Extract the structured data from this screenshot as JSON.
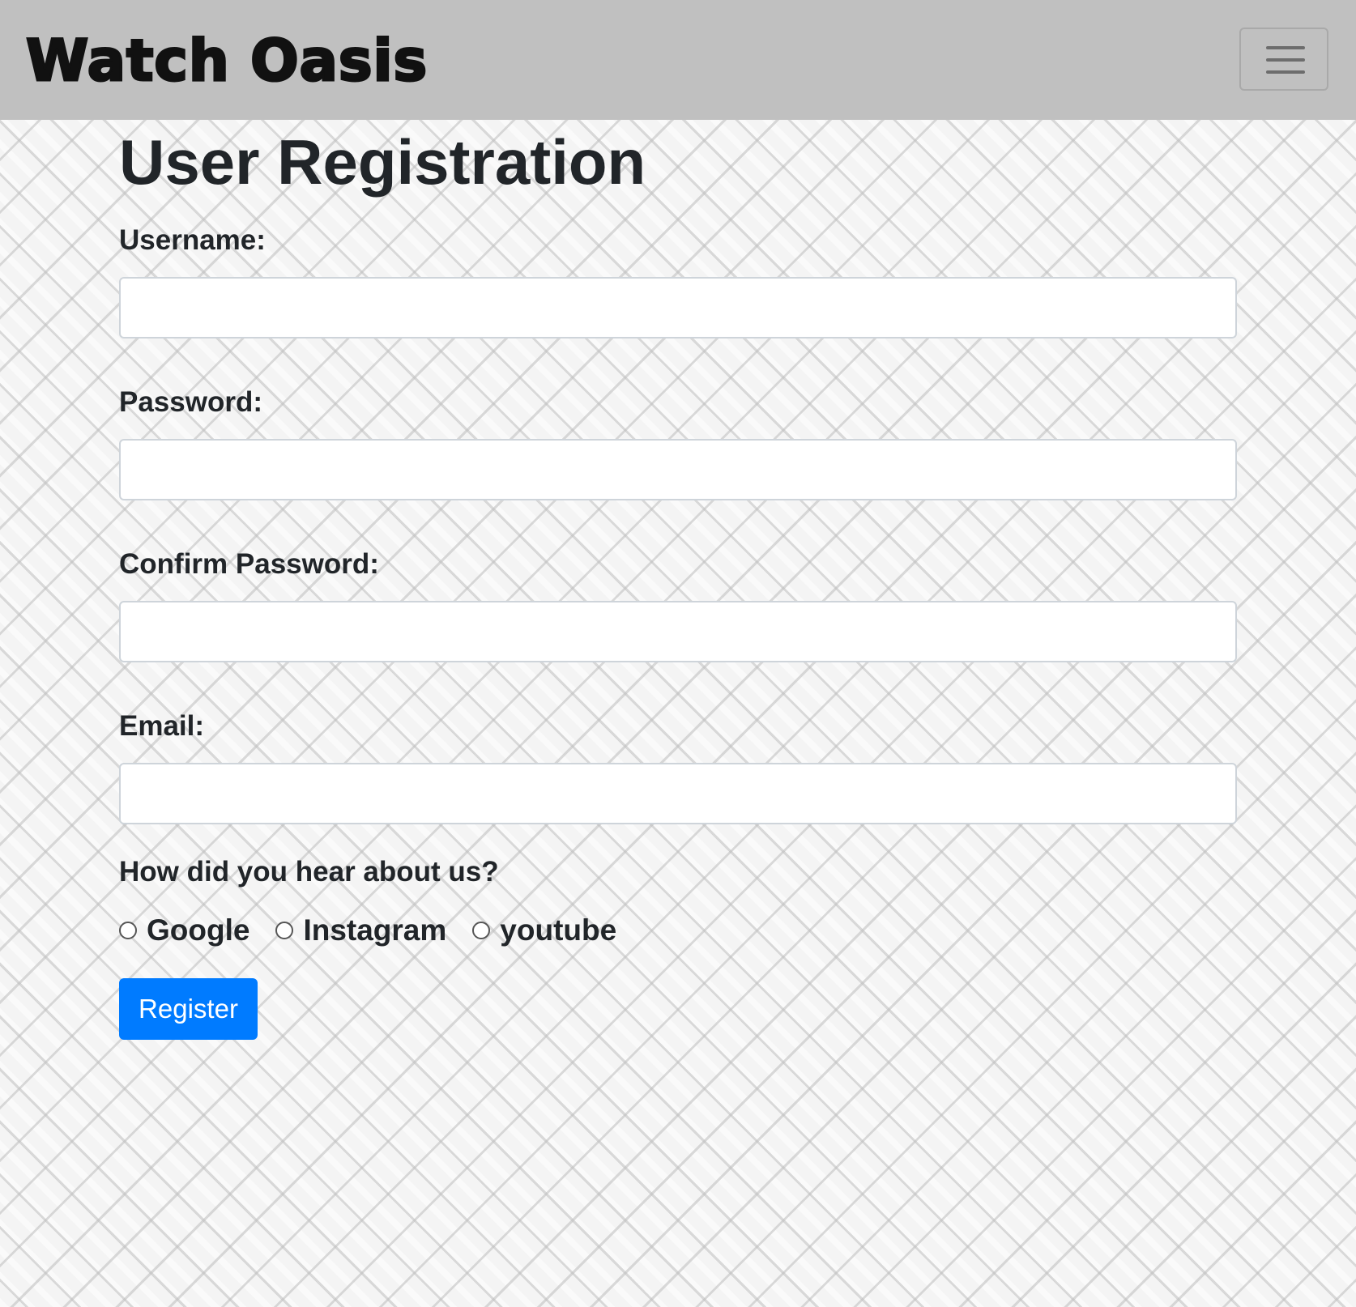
{
  "navbar": {
    "brand": "Watch Oasis",
    "toggler_icon": "hamburger-menu-icon",
    "background": "#c0c0c0"
  },
  "page": {
    "title": "User Registration"
  },
  "form": {
    "username": {
      "label": "Username:",
      "value": "",
      "placeholder": ""
    },
    "password": {
      "label": "Password:",
      "value": "",
      "placeholder": ""
    },
    "confirm_password": {
      "label": "Confirm Password:",
      "value": "",
      "placeholder": ""
    },
    "email": {
      "label": "Email:",
      "value": "",
      "placeholder": ""
    },
    "referral": {
      "question": "How did you hear about us?",
      "options": [
        {
          "label": "Google",
          "selected": false
        },
        {
          "label": "Instagram",
          "selected": false
        },
        {
          "label": "youtube",
          "selected": false
        }
      ]
    },
    "submit_label": "Register",
    "accent_color": "#007bff"
  }
}
